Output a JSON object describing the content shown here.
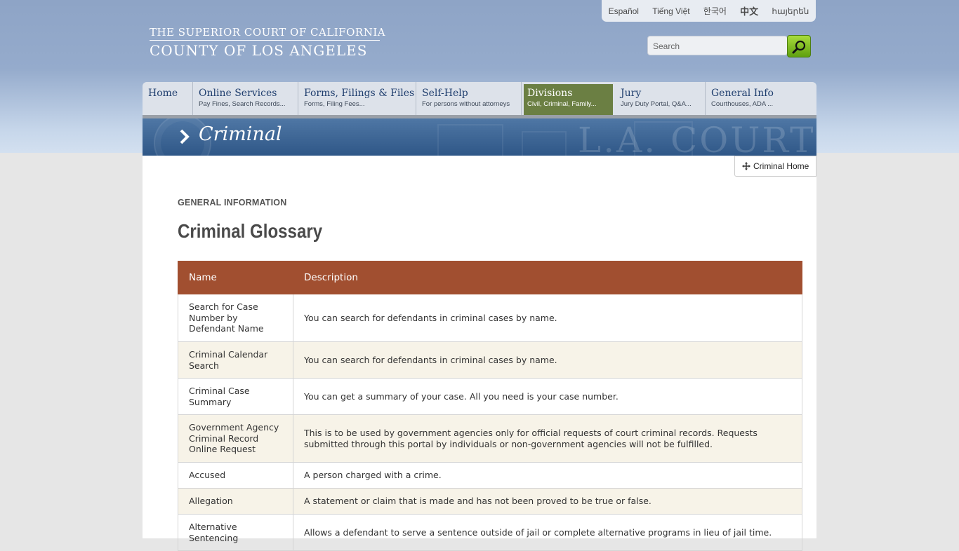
{
  "header": {
    "logo_line1": "THE SUPERIOR COURT OF CALIFORNIA",
    "logo_line2": "COUNTY OF LOS ANGELES",
    "languages": [
      "Español",
      "Tiếng Việt",
      "한국어",
      "中文",
      "հայերեն"
    ],
    "search_placeholder": "Search"
  },
  "nav": [
    {
      "title": "Home",
      "sub": ""
    },
    {
      "title": "Online Services",
      "sub": "Pay Fines, Search Records..."
    },
    {
      "title": "Forms, Filings & Files",
      "sub": "Forms, Filing Fees..."
    },
    {
      "title": "Self-Help",
      "sub": "For persons without attorneys"
    },
    {
      "title": "Divisions",
      "sub": "Civil, Criminal, Family..."
    },
    {
      "title": "Jury",
      "sub": "Jury Duty Portal, Q&A..."
    },
    {
      "title": "General Info",
      "sub": "Courthouses, ADA ..."
    }
  ],
  "banner": {
    "title": "Criminal",
    "watermark": "L.A. COURT"
  },
  "content": {
    "crumb_button": "Criminal Home",
    "section_label": "GENERAL INFORMATION",
    "page_title": "Criminal Glossary",
    "table": {
      "headers": [
        "Name",
        "Description"
      ],
      "rows": [
        {
          "name": "Search for Case Number by Defendant Name",
          "desc": "You can search for defendants in criminal cases by name."
        },
        {
          "name": "Criminal Calendar Search",
          "desc": "You can search for defendants in criminal cases by name."
        },
        {
          "name": "Criminal Case Summary",
          "desc": "You can get a summary of your case. All you need is your case number."
        },
        {
          "name": "Government Agency Criminal Record Online Request",
          "desc": "This is to be used by government agencies only for official requests of court criminal records. Requests submitted through this portal by individuals or non-government agencies will not be fulfilled."
        },
        {
          "name": "Accused",
          "desc": "A person charged with a crime."
        },
        {
          "name": "Allegation",
          "desc": "A statement or claim that is made and has not been proved to be true or false."
        },
        {
          "name": "Alternative Sentencing",
          "desc": "Allows a defendant to serve a sentence outside of jail or complete alternative programs in lieu of jail time."
        }
      ]
    }
  }
}
